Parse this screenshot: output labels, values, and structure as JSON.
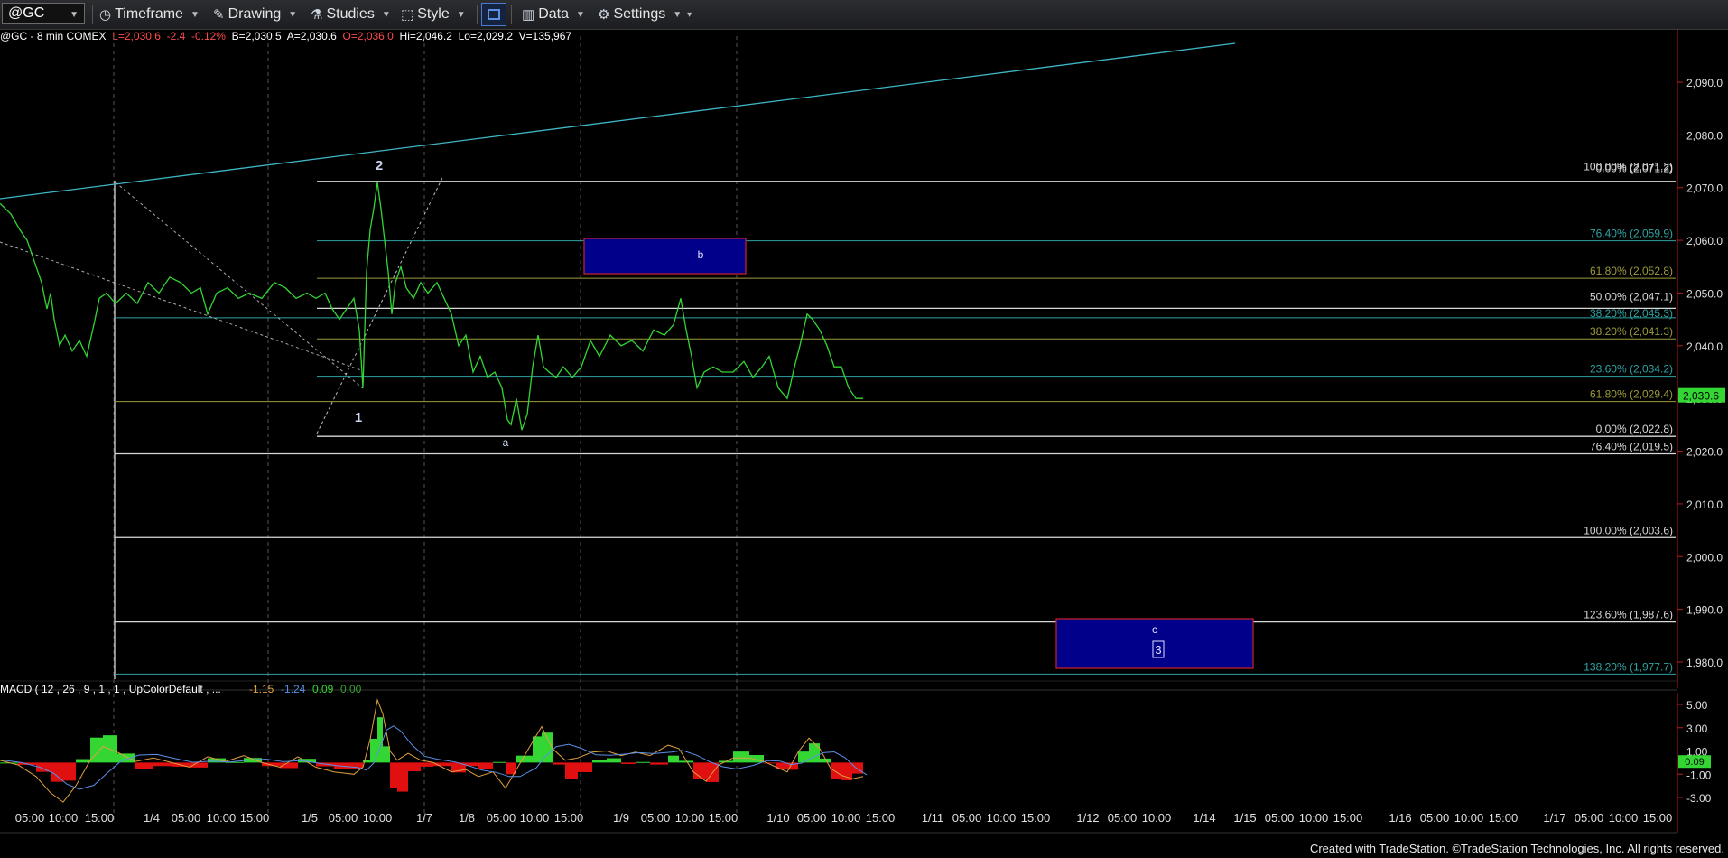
{
  "toolbar": {
    "symbol": "@GC",
    "timeframe": "Timeframe",
    "drawing": "Drawing",
    "studies": "Studies",
    "style": "Style",
    "data": "Data",
    "settings": "Settings"
  },
  "info": {
    "title": "@GC - 8 min  COMEX",
    "last": "L=2,030.6",
    "change": "-2.4",
    "pct": "-0.12%",
    "bid": "B=2,030.5",
    "ask": "A=2,030.6",
    "open": "O=2,036.0",
    "high": "Hi=2,046.2",
    "low": "Lo=2,029.2",
    "volume": "V=135,967"
  },
  "colors": {
    "price": "#33d633",
    "fib_teal": "#2fa3a3",
    "fib_olive": "#9c9a3a",
    "fib_white": "#d8d8d8",
    "box_fill": "#00008b",
    "box_border": "#c0202a",
    "trendline": "#3fb6c6",
    "macd_line": "#e0a040",
    "signal_line": "#5b8fe6",
    "hist_up": "#33d633",
    "hist_down": "#e01010"
  },
  "price_axis": {
    "min": 1975,
    "max": 2098,
    "ticks": [
      "2,090.0",
      "2,080.0",
      "2,070.0",
      "2,060.0",
      "2,050.0",
      "2,040.0",
      "2,030.0",
      "2,020.0",
      "2,010.0",
      "2,000.0",
      "1,990.0",
      "1,980.0"
    ],
    "tick_values": [
      2090,
      2080,
      2070,
      2060,
      2050,
      2040,
      2030,
      2020,
      2010,
      2000,
      1990,
      1980
    ],
    "current": "2,030.6",
    "current_value": 2030.6
  },
  "fib_levels": [
    {
      "label": "100.00% (2,071.2)",
      "value": 2071.2,
      "color": "fib_white"
    },
    {
      "label": "0.00% (2,071.2)",
      "value": 2071.2,
      "color": "fib_white"
    },
    {
      "label": "76.40% (2,059.9)",
      "value": 2059.9,
      "color": "fib_teal"
    },
    {
      "label": "61.80% (2,052.8)",
      "value": 2052.8,
      "color": "fib_olive"
    },
    {
      "label": "50.00% (2,047.1)",
      "value": 2047.1,
      "color": "fib_white"
    },
    {
      "label": "38.20% (2,045.3)",
      "value": 2045.3,
      "color": "fib_teal"
    },
    {
      "label": "38.20% (2,041.3)",
      "value": 2041.3,
      "color": "fib_olive"
    },
    {
      "label": "23.60% (2,034.2)",
      "value": 2034.2,
      "color": "fib_teal"
    },
    {
      "label": "61.80% (2,029.4)",
      "value": 2029.4,
      "color": "fib_olive"
    },
    {
      "label": "0.00% (2,022.8)",
      "value": 2022.8,
      "color": "fib_white"
    },
    {
      "label": "76.40% (2,019.5)",
      "value": 2019.5,
      "color": "fib_white"
    },
    {
      "label": "100.00% (2,003.6)",
      "value": 2003.6,
      "color": "fib_white"
    },
    {
      "label": "123.60% (1,987.6)",
      "value": 1987.6,
      "color": "fib_white"
    },
    {
      "label": "138.20% (1,977.7)",
      "value": 1977.7,
      "color": "fib_teal"
    }
  ],
  "wave_labels": [
    {
      "text": "2"
    },
    {
      "text": "1"
    },
    {
      "text": "a"
    },
    {
      "text": "b"
    },
    {
      "text": "c"
    },
    {
      "text": "3"
    }
  ],
  "macd": {
    "label": "MACD ( 12 , 26 , 9 , 1 , 1 , UpColorDefault , ...",
    "v1": "-1.15",
    "v2": "-1.24",
    "v3": "0.09",
    "v4": "0.00",
    "axis_min": -4.2,
    "axis_max": 6.5,
    "ticks": [
      "5.00",
      "3.00",
      "1.00",
      "-1.00",
      "-3.00"
    ],
    "tick_values": [
      5,
      3,
      1,
      -1,
      -3
    ],
    "current": "0.09"
  },
  "time_axis": {
    "labels": [
      "05:00",
      "10:00",
      "15:00",
      "1/4",
      "05:00",
      "10:00",
      "15:00",
      "1/5",
      "05:00",
      "10:00",
      "1/7",
      "1/8",
      "05:00",
      "10:00",
      "15:00",
      "1/9",
      "05:00",
      "10:00",
      "15:00",
      "1/10",
      "05:00",
      "10:00",
      "15:00",
      "1/11",
      "05:00",
      "10:00",
      "15:00",
      "1/12",
      "05:00",
      "10:00",
      "1/14",
      "1/15",
      "05:00",
      "10:00",
      "15:00",
      "1/16",
      "05:00",
      "10:00",
      "15:00",
      "1/17",
      "05:00",
      "10:00",
      "15:00"
    ]
  },
  "footer": "Created with TradeStation. ©TradeStation Technologies, Inc. All rights reserved."
}
